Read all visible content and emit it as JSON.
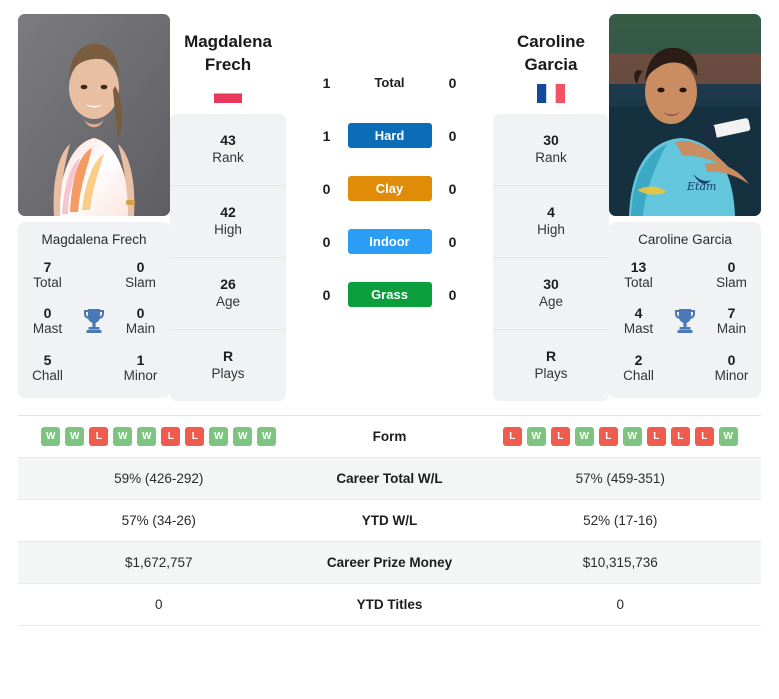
{
  "left": {
    "name_line1": "Magdalena",
    "name_line2": "Frech",
    "caption": "Magdalena Frech",
    "flag": "poland-flag",
    "stats": [
      {
        "value": "43",
        "label": "Rank"
      },
      {
        "value": "42",
        "label": "High"
      },
      {
        "value": "26",
        "label": "Age"
      },
      {
        "value": "R",
        "label": "Plays"
      }
    ],
    "titles": [
      {
        "value": "7",
        "label": "Total"
      },
      {
        "value": "0",
        "label": "Slam"
      },
      {
        "value": "0",
        "label": "Mast"
      },
      {
        "value": "0",
        "label": "Main"
      },
      {
        "value": "5",
        "label": "Chall"
      },
      {
        "value": "1",
        "label": "Minor"
      }
    ],
    "h2h": {
      "total": "1",
      "hard": "1",
      "clay": "0",
      "indoor": "0",
      "grass": "0"
    },
    "form": [
      "W",
      "W",
      "L",
      "W",
      "W",
      "L",
      "L",
      "W",
      "W",
      "W"
    ],
    "career_wl": "59% (426-292)",
    "ytd_wl": "57% (34-26)",
    "prize": "$1,672,757",
    "ytd_titles": "0"
  },
  "right": {
    "name_line1": "Caroline",
    "name_line2": "Garcia",
    "caption": "Caroline Garcia",
    "flag": "france-flag",
    "stats": [
      {
        "value": "30",
        "label": "Rank"
      },
      {
        "value": "4",
        "label": "High"
      },
      {
        "value": "30",
        "label": "Age"
      },
      {
        "value": "R",
        "label": "Plays"
      }
    ],
    "titles": [
      {
        "value": "13",
        "label": "Total"
      },
      {
        "value": "0",
        "label": "Slam"
      },
      {
        "value": "4",
        "label": "Mast"
      },
      {
        "value": "7",
        "label": "Main"
      },
      {
        "value": "2",
        "label": "Chall"
      },
      {
        "value": "0",
        "label": "Minor"
      }
    ],
    "h2h": {
      "total": "0",
      "hard": "0",
      "clay": "0",
      "indoor": "0",
      "grass": "0"
    },
    "form": [
      "L",
      "W",
      "L",
      "W",
      "L",
      "W",
      "L",
      "L",
      "L",
      "W"
    ],
    "career_wl": "57% (459-351)",
    "ytd_wl": "52% (17-16)",
    "prize": "$10,315,736",
    "ytd_titles": "0"
  },
  "surfaces": {
    "total": "Total",
    "hard": "Hard",
    "clay": "Clay",
    "indoor": "Indoor",
    "grass": "Grass"
  },
  "table_labels": {
    "form": "Form",
    "career_wl": "Career Total W/L",
    "ytd_wl": "YTD W/L",
    "prize": "Career Prize Money",
    "ytd_titles": "YTD Titles"
  },
  "colors": {
    "hard": "#0b6cb8",
    "clay": "#e08c09",
    "indoor": "#2a9df4",
    "grass": "#0a9e3d",
    "win": "#7cc47f",
    "loss": "#ef5b4c",
    "trophy": "#4a7ab5"
  }
}
